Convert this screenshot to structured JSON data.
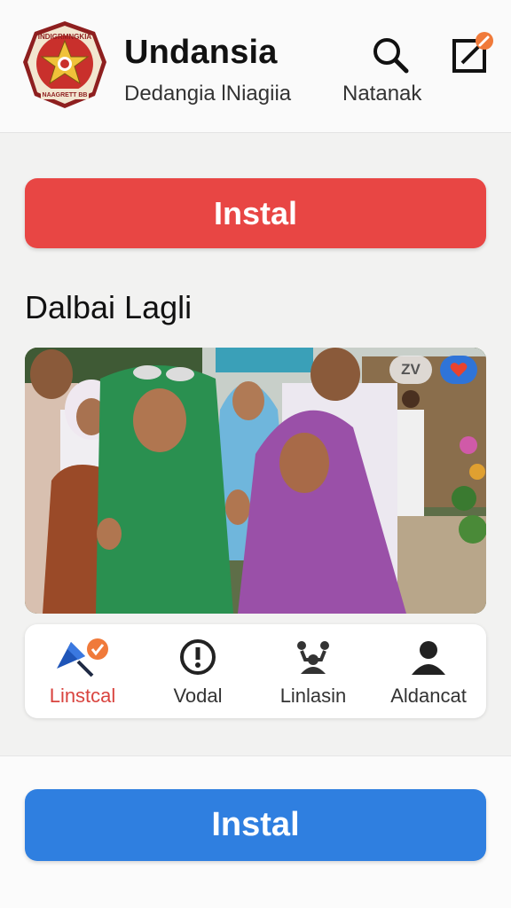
{
  "header": {
    "title": "Undansia",
    "subtitle": "Dedangia lNiagiia",
    "right_label": "Natanak",
    "logo": {
      "top_text": "INDIGRMNGKIA",
      "bottom_text": "NAAGRETT BB"
    },
    "search_icon": "search-icon",
    "edit_icon": "edit-square-icon",
    "edit_badge_color": "#f07a3a"
  },
  "actions": {
    "install_top_label": "Instal",
    "install_top_color": "#e84644",
    "install_bottom_label": "Instal",
    "install_bottom_color": "#2f7fe0"
  },
  "section": {
    "title": "Dalbai Lagli"
  },
  "photo": {
    "count_badge": "ZV",
    "heart_icon": "heart-icon"
  },
  "tabs": [
    {
      "label": "Linstcal",
      "icon": "pin-icon",
      "active": true
    },
    {
      "label": "Vodal",
      "icon": "info-circle-icon",
      "active": false
    },
    {
      "label": "Linlasin",
      "icon": "group-icon",
      "active": false
    },
    {
      "label": "Aldancat",
      "icon": "person-icon",
      "active": false
    }
  ]
}
